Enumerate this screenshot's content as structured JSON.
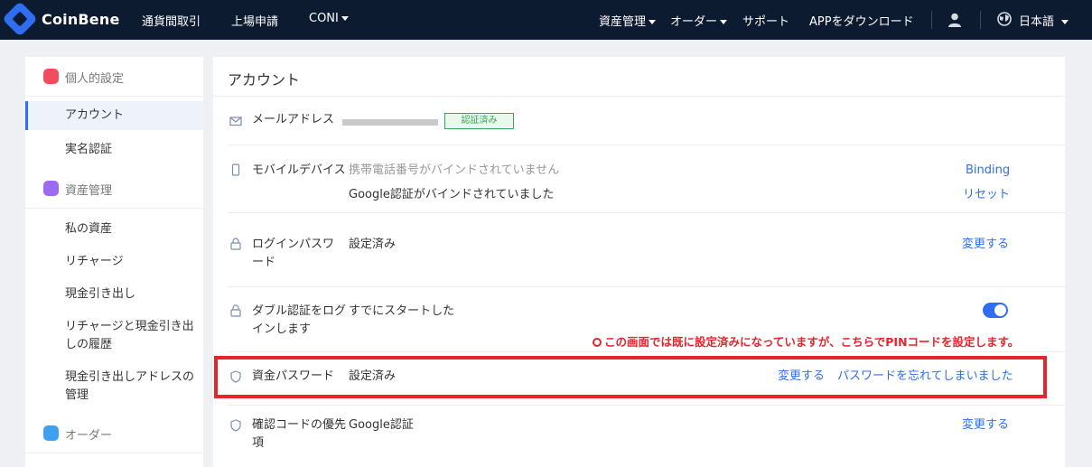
{
  "topbar": {
    "brand": "CoinBene",
    "nav_left": [
      "通貨間取引",
      "上場申請",
      "CONI"
    ],
    "nav_right": [
      "資産管理",
      "オーダー",
      "サポート",
      "APPをダウンロード"
    ],
    "language": "日本語",
    "icons": {
      "logo": "coinbene-logo-icon",
      "user": "user-icon",
      "language": "globe-icon"
    },
    "colors": {
      "background": "#0d1b31",
      "accent": "#2f6ef2"
    }
  },
  "sidebar": {
    "groups": [
      {
        "label": "個人的設定",
        "icon": "personal-settings-icon",
        "color": "#f04e5e"
      },
      {
        "label": "資産管理",
        "icon": "asset-management-icon",
        "color": "#9b6cf2"
      },
      {
        "label": "オーダー",
        "icon": "orders-icon",
        "color": "#3fa0f0"
      }
    ],
    "items": [
      {
        "label": "アカウント",
        "active": true
      },
      {
        "label": "実名認証"
      },
      {
        "label": "私の資産"
      },
      {
        "label": "リチャージ"
      },
      {
        "label": "現金引き出し"
      },
      {
        "label": "リチャージと現金引き出しの履歴"
      },
      {
        "label": "現金引き出しアドレスの管理"
      }
    ]
  },
  "main": {
    "title": "アカウント",
    "rows": {
      "email": {
        "label": "メールアドレス",
        "badge": "認証済み",
        "icon": "mail-icon"
      },
      "mobile": {
        "label": "モバイルデバイス",
        "icon": "mobile-icon",
        "phone_status": "携帯電話番号がバインドされていません",
        "phone_action": "Binding",
        "google_status": "Google認証がバインドされていました",
        "google_action": "リセット"
      },
      "login_password": {
        "label": "ログインパスワード",
        "value": "設定済み",
        "action": "変更する",
        "icon": "lock-icon"
      },
      "two_factor": {
        "label": "ダブル認証をログインします",
        "value": "すでにスタートした",
        "enabled": true,
        "icon": "lock-icon"
      },
      "fund_password": {
        "label": "資金パスワード",
        "value": "設定済み",
        "action": "変更する",
        "action2": "パスワードを忘れてしまいました",
        "icon": "shield-icon"
      },
      "verification_priority": {
        "label": "確認コードの優先項",
        "value": "Google認証",
        "action": "変更する",
        "icon": "shield-icon"
      }
    }
  },
  "annotation": {
    "text": "この画面では既に設定済みになっていますが、こちらでPINコードを設定します。",
    "color": "#e5242b"
  }
}
